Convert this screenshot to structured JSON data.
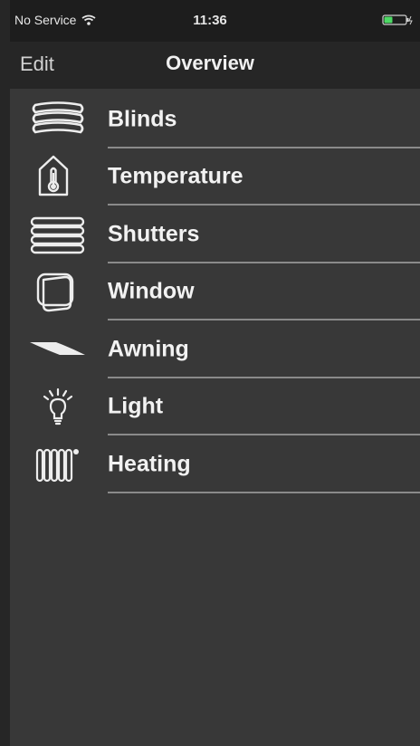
{
  "status_bar": {
    "carrier": "No Service",
    "time": "11:36"
  },
  "nav": {
    "edit_label": "Edit",
    "title": "Overview"
  },
  "items": [
    {
      "label": "Blinds",
      "icon": "blinds-icon"
    },
    {
      "label": "Temperature",
      "icon": "temperature-icon"
    },
    {
      "label": "Shutters",
      "icon": "shutters-icon"
    },
    {
      "label": "Window",
      "icon": "window-icon"
    },
    {
      "label": "Awning",
      "icon": "awning-icon"
    },
    {
      "label": "Light",
      "icon": "light-bulb-icon"
    },
    {
      "label": "Heating",
      "icon": "radiator-icon"
    }
  ],
  "colors": {
    "background": "#383838",
    "nav_background": "#262626",
    "status_background": "#1d1d1d",
    "text": "#f2f2f2",
    "battery_green": "#4cd964"
  }
}
